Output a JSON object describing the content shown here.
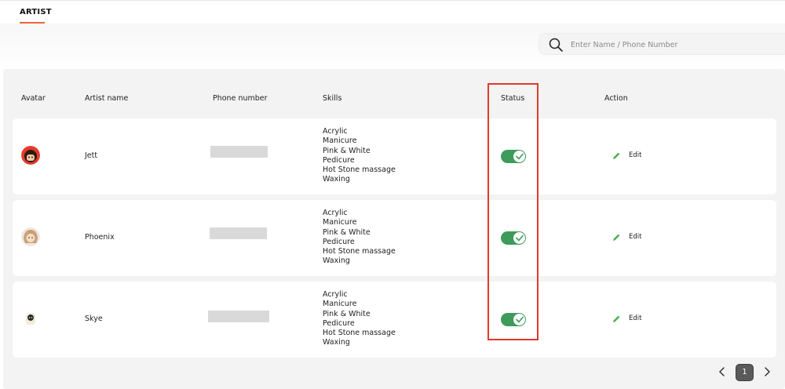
{
  "tabs": {
    "artist": "ARTIST"
  },
  "search": {
    "placeholder": "Enter Name / Phone Number"
  },
  "table": {
    "headers": {
      "avatar": "Avatar",
      "artist_name": "Artist name",
      "phone_number": "Phone number",
      "skills": "Skills",
      "status": "Status",
      "action": "Action"
    },
    "rows": [
      {
        "name": "Jett",
        "skills": [
          "Acrylic",
          "Manicure",
          "Pink & White",
          "Pedicure",
          "Hot Stone massage",
          "Waxing"
        ],
        "status_active": true,
        "edit_label": "Edit"
      },
      {
        "name": "Phoenix",
        "skills": [
          "Acrylic",
          "Manicure",
          "Pink & White",
          "Pedicure",
          "Hot Stone massage",
          "Waxing"
        ],
        "status_active": true,
        "edit_label": "Edit"
      },
      {
        "name": "Skye",
        "skills": [
          "Acrylic",
          "Manicure",
          "Pink & White",
          "Pedicure",
          "Hot Stone massage",
          "Waxing"
        ],
        "status_active": true,
        "edit_label": "Edit"
      }
    ]
  },
  "pagination": {
    "current": "1"
  },
  "colors": {
    "accent": "#f0643c",
    "toggle_on": "#3e9b5b",
    "edit_icon": "#4caf50",
    "highlight": "#e03a2b"
  },
  "icons": {
    "search": "search-icon",
    "edit": "pencil-icon",
    "check": "check-icon",
    "prev": "chevron-left-icon",
    "next": "chevron-right-icon"
  }
}
